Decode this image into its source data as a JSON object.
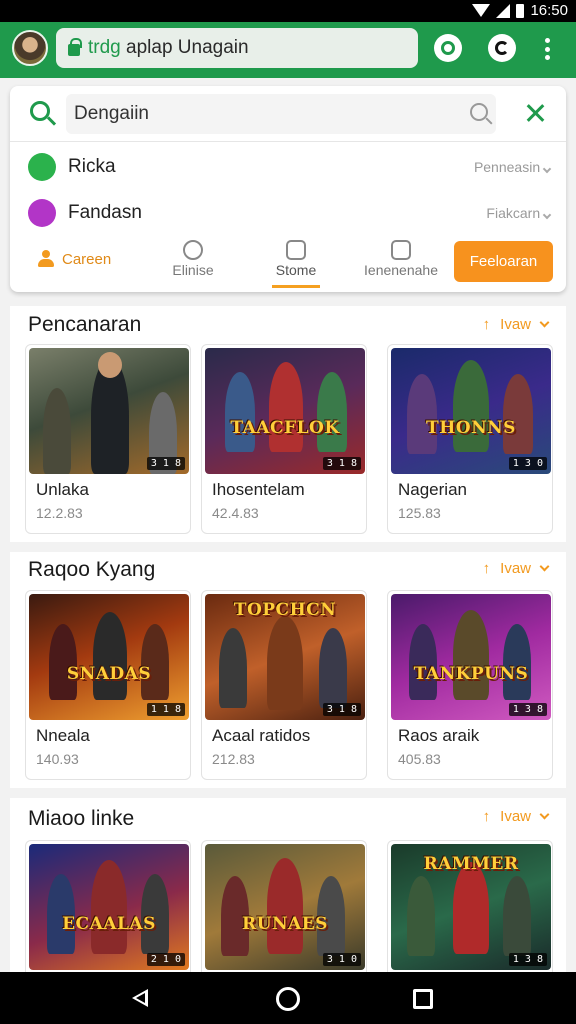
{
  "status_bar": {
    "time": "16:50"
  },
  "browser": {
    "url_prefix": "trdg",
    "url_rest": " aplap Unagain"
  },
  "search": {
    "value": "Dengaiin"
  },
  "suggestions": [
    {
      "label": "Ricka",
      "meta": "Penneasin",
      "icon": "globe-icon",
      "color": "#2bb24c"
    },
    {
      "label": "Fandasn",
      "meta": "Fiakcarn",
      "icon": "messenger-icon",
      "color": "#b235c7"
    }
  ],
  "tabs": [
    {
      "label": "Careen",
      "icon": "person-icon"
    },
    {
      "label": "Elinise",
      "icon": "compass-icon"
    },
    {
      "label": "Stome",
      "icon": "store-icon"
    },
    {
      "label": "Ienenenahe",
      "icon": "library-icon"
    }
  ],
  "cta_label": "Feeloaran",
  "sections": [
    {
      "title": "Pencanaran",
      "action": "Ivaw",
      "games": [
        {
          "name": "Unlaka",
          "meta": "12.2.83",
          "badge": "3 1 8",
          "thumb_title": ""
        },
        {
          "name": "Ihosentelam",
          "meta": "42.4.83",
          "badge": "3 1 8",
          "thumb_title": "TAACFLOK"
        },
        {
          "name": "Nagerian",
          "meta": "125.83",
          "badge": "1 3 0",
          "thumb_title": "THONNS"
        }
      ]
    },
    {
      "title": "Raqoo Kyang",
      "action": "Ivaw",
      "games": [
        {
          "name": "Nneala",
          "meta": "140.93",
          "badge": "1 1 8",
          "thumb_title": "SNADAS"
        },
        {
          "name": "Acaal ratidos",
          "meta": "212.83",
          "badge": "3 1 8",
          "thumb_title": "TOPCHCN"
        },
        {
          "name": "Raos araik",
          "meta": "405.83",
          "badge": "1 3 8",
          "thumb_title": "TANKPUNS"
        }
      ]
    },
    {
      "title": "Miaoo linke",
      "action": "Ivaw",
      "games": [
        {
          "name": "",
          "meta": "",
          "badge": "2 1 0",
          "thumb_title": "ECAALAS"
        },
        {
          "name": "",
          "meta": "",
          "badge": "3 1 0",
          "thumb_title": "RUNAES"
        },
        {
          "name": "",
          "meta": "",
          "badge": "1 3 8",
          "thumb_title": "RAMMER"
        }
      ]
    }
  ]
}
